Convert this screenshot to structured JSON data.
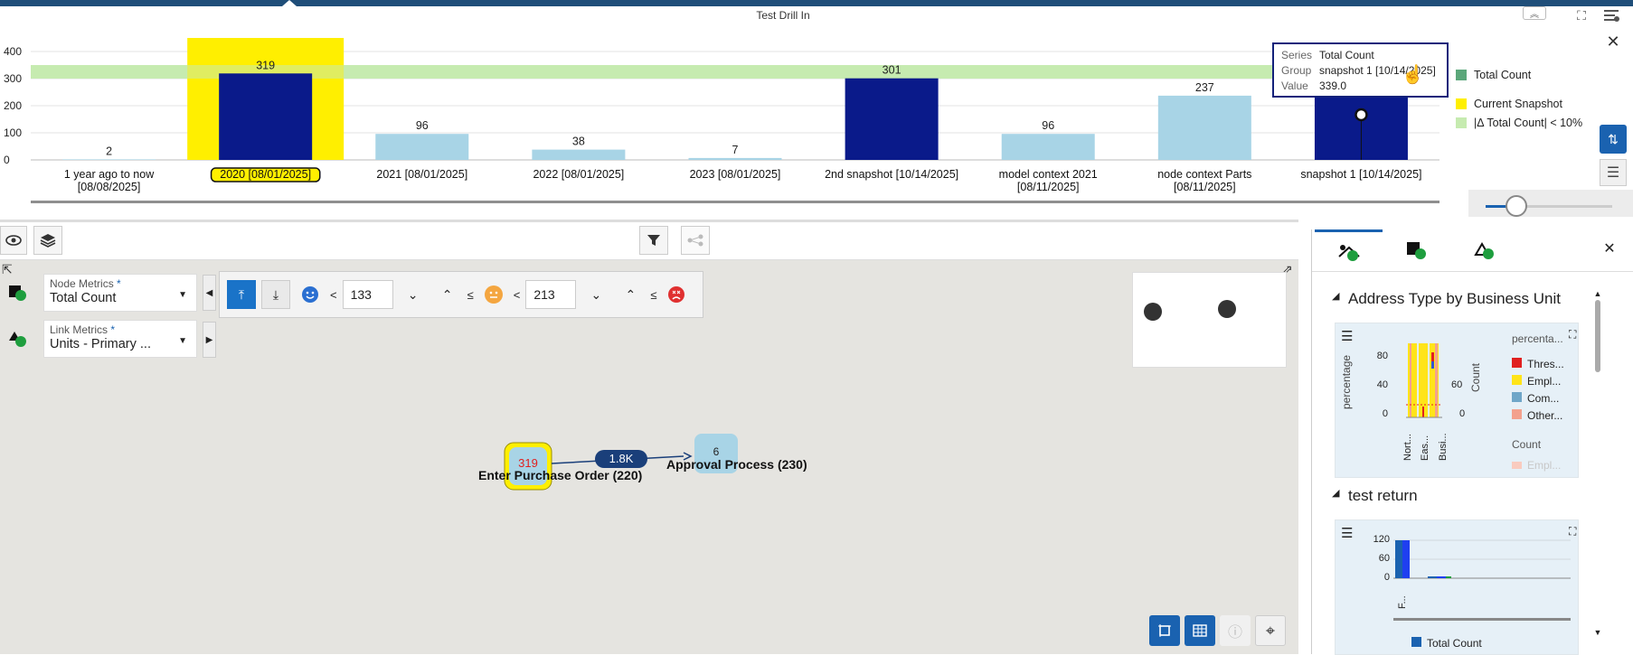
{
  "window": {
    "title": "Test Drill In"
  },
  "chart_data": {
    "type": "bar",
    "categories": [
      "1 year ago to now [08/08/2025]",
      "2020 [08/01/2025]",
      "2021 [08/01/2025]",
      "2022 [08/01/2025]",
      "2023 [08/01/2025]",
      "2nd snapshot [10/14/2025]",
      "model context 2021 [08/11/2025]",
      "node context Parts [08/11/2025]",
      "snapshot 1 [10/14/2025]"
    ],
    "category_lines": [
      [
        "1 year ago to now",
        "[08/08/2025]"
      ],
      [
        "2020 [08/01/2025]"
      ],
      [
        "2021 [08/01/2025]"
      ],
      [
        "2022 [08/01/2025]"
      ],
      [
        "2023 [08/01/2025]"
      ],
      [
        "2nd snapshot [10/14/2025]"
      ],
      [
        "model context 2021",
        "[08/11/2025]"
      ],
      [
        "node context Parts",
        "[08/11/2025]"
      ],
      [
        "snapshot 1 [10/14/2025]"
      ]
    ],
    "series": [
      {
        "name": "Total Count",
        "values": [
          2,
          319,
          96,
          38,
          7,
          301,
          96,
          237,
          339
        ]
      }
    ],
    "data_labels": [
      "2",
      "319",
      "96",
      "38",
      "7",
      "301",
      "96",
      "237",
      ""
    ],
    "bar_colors": [
      "#a8d4e6",
      "#0a1a8a",
      "#a8d4e6",
      "#a8d4e6",
      "#a8d4e6",
      "#0a1a8a",
      "#a8d4e6",
      "#a8d4e6",
      "#0a1a8a"
    ],
    "highlight_index": 1,
    "current_snapshot_color": "#ffef00",
    "band": {
      "from": 300,
      "to": 350,
      "color": "#c6ebb0"
    },
    "y_ticks": [
      0,
      100,
      200,
      300,
      400
    ],
    "ylim": [
      0,
      450
    ],
    "grid": true,
    "legend_position": "right"
  },
  "legend": [
    {
      "label": "Total Count",
      "color": "#5ba77a"
    },
    {
      "label": "Current Snapshot",
      "color": "#ffef00"
    },
    {
      "label": "|Δ Total Count| < 10%",
      "color": "#c6ebb0"
    }
  ],
  "tooltip": {
    "series_key": "Series",
    "series": "Total Count",
    "group_key": "Group",
    "group": "snapshot 1 [10/14/2025]",
    "value_key": "Value",
    "value": "339.0"
  },
  "slider": {
    "value": 0.22
  },
  "metrics": {
    "node": {
      "label": "Node Metrics",
      "value": "Total Count",
      "required": "*"
    },
    "link": {
      "label": "Link Metrics",
      "value": "Units - Primary ...",
      "required": "*"
    }
  },
  "thresholds": {
    "op1": "<",
    "value1": "133",
    "op2": "≤",
    "op3": "<",
    "value2": "213",
    "op4": "≤"
  },
  "graph": {
    "node1": {
      "count": "319",
      "label": "Enter Purchase Order (220)"
    },
    "link": {
      "label": "1.8K"
    },
    "node2": {
      "count": "6",
      "label": "Approval Process (230)"
    }
  },
  "side_panel": {
    "section1": {
      "title": "Address Type by Business Unit",
      "y_title": "percentage",
      "y_ticks": [
        "80",
        "40",
        "0"
      ],
      "y2_title": "Count",
      "y2_ticks": [
        "60",
        "0"
      ],
      "x_labels": [
        "Nort...",
        "Eas...",
        "Busi..."
      ],
      "legend_title": "percenta...",
      "legend": [
        {
          "label": "Thres...",
          "color": "#e02020"
        },
        {
          "label": "Empl...",
          "color": "#ffe419"
        },
        {
          "label": "Com...",
          "color": "#6fa6c8"
        },
        {
          "label": "Other...",
          "color": "#f3a18e"
        }
      ],
      "legend2_title": "Count",
      "legend2_item": "Empl..."
    },
    "section2": {
      "title": "test return",
      "y_ticks": [
        "120",
        "60",
        "0"
      ],
      "x_label": "F...",
      "legend": "Total Count"
    }
  }
}
